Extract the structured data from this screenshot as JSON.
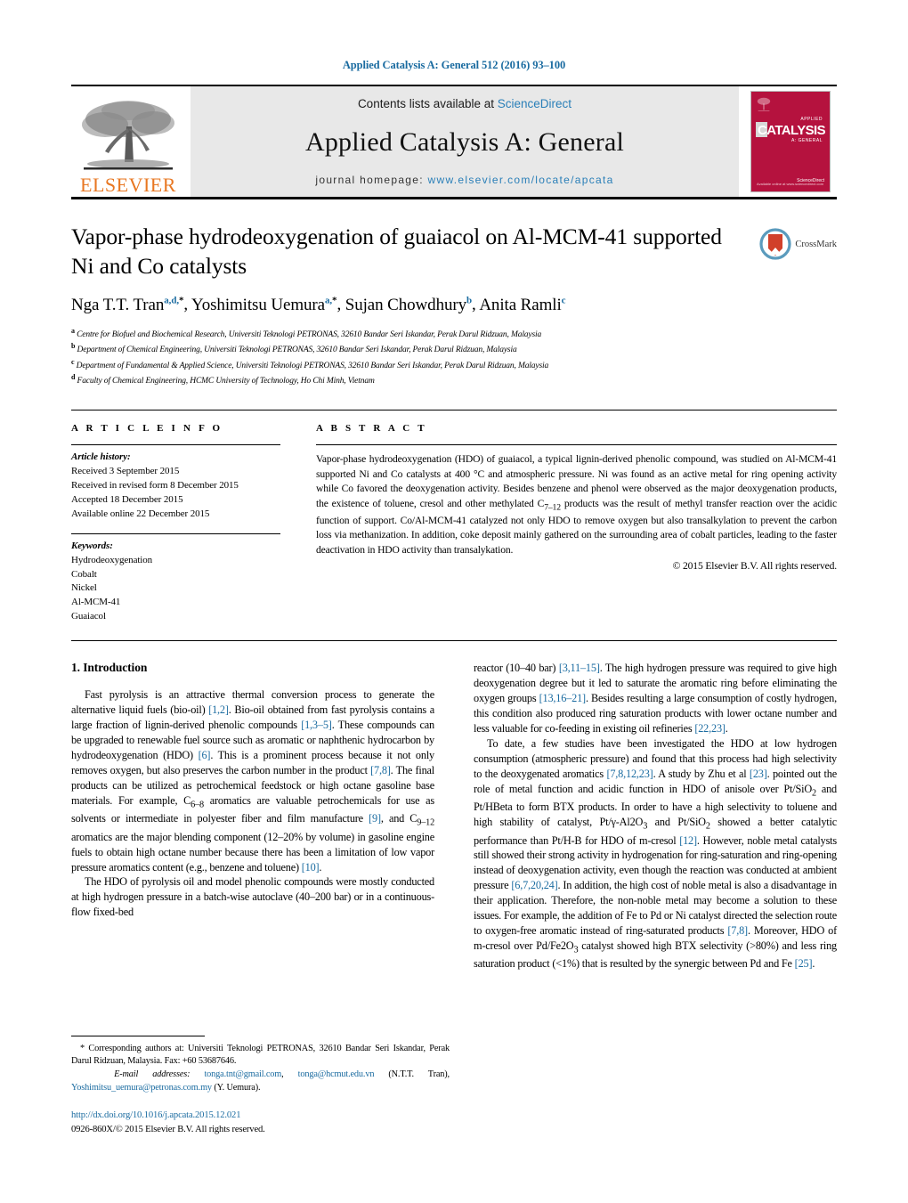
{
  "running_head": "Applied Catalysis A: General 512 (2016) 93–100",
  "masthead": {
    "publisher_wordmark": "ELSEVIER",
    "contents_prefix": "Contents lists available at ",
    "contents_link": "ScienceDirect",
    "journal_name": "Applied Catalysis A: General",
    "homepage_prefix": "journal homepage: ",
    "homepage_url": "www.elsevier.com/locate/apcata",
    "cover": {
      "title": "CATALYSIS",
      "sub_top": "APPLIED",
      "sub_bottom": "A: GENERAL",
      "footer_left": "Available online at www.sciencedirect.com",
      "footer_right": "ScienceDirect"
    }
  },
  "crossmark": {
    "label": "CrossMark"
  },
  "article": {
    "title": "Vapor-phase hydrodeoxygenation of guaiacol on Al-MCM-41 supported Ni and Co catalysts",
    "authors": [
      {
        "name": "Nga T.T. Tran",
        "marks": "a,d,",
        "star": true,
        "sep": ", "
      },
      {
        "name": "Yoshimitsu Uemura",
        "marks": "a,",
        "star": true,
        "sep": ", "
      },
      {
        "name": "Sujan Chowdhury",
        "marks": "b",
        "star": false,
        "sep": ", "
      },
      {
        "name": "Anita Ramli",
        "marks": "c",
        "star": false,
        "sep": ""
      }
    ],
    "affiliations": [
      {
        "mark": "a",
        "text": "Centre for Biofuel and Biochemical Research, Universiti Teknologi PETRONAS, 32610 Bandar Seri Iskandar, Perak Darul Ridzuan, Malaysia"
      },
      {
        "mark": "b",
        "text": "Department of Chemical Engineering, Universiti Teknologi PETRONAS, 32610 Bandar Seri Iskandar, Perak Darul Ridzuan, Malaysia"
      },
      {
        "mark": "c",
        "text": "Department of Fundamental & Applied Science, Universiti Teknologi PETRONAS, 32610 Bandar Seri Iskandar, Perak Darul Ridzuan, Malaysia"
      },
      {
        "mark": "d",
        "text": "Faculty of Chemical Engineering, HCMC University of Technology, Ho Chi Minh, Vietnam"
      }
    ]
  },
  "article_info": {
    "heading": "A R T I C L E  I N F O",
    "history_label": "Article history:",
    "history": [
      "Received 3 September 2015",
      "Received in revised form 8 December 2015",
      "Accepted 18 December 2015",
      "Available online 22 December 2015"
    ],
    "keywords_label": "Keywords:",
    "keywords": [
      "Hydrodeoxygenation",
      "Cobalt",
      "Nickel",
      "Al-MCM-41",
      "Guaiacol"
    ]
  },
  "abstract": {
    "heading": "A B S T R A C T",
    "text": "Vapor-phase hydrodeoxygenation (HDO) of guaiacol, a typical lignin-derived phenolic compound, was studied on Al-MCM-41 supported Ni and Co catalysts at 400 °C and atmospheric pressure. Ni was found as an active metal for ring opening activity while Co favored the deoxygenation activity. Besides benzene and phenol were observed as the major deoxygenation products, the existence of toluene, cresol and other methylated C7–12 products was the result of methyl transfer reaction over the acidic function of support. Co/Al-MCM-41 catalyzed not only HDO to remove oxygen but also transalkylation to prevent the carbon loss via methanization. In addition, coke deposit mainly gathered on the surrounding area of cobalt particles, leading to the faster deactivation in HDO activity than transalykation.",
    "copyright": "© 2015 Elsevier B.V. All rights reserved."
  },
  "body": {
    "section_number_title": "1.  Introduction",
    "left_paragraphs": [
      "Fast pyrolysis is an attractive thermal conversion process to generate the alternative liquid fuels (bio-oil) [1,2]. Bio-oil obtained from fast pyrolysis contains a large fraction of lignin-derived phenolic compounds [1,3–5]. These compounds can be upgraded to renewable fuel source such as aromatic or naphthenic hydrocarbon by hydrodeoxygenation (HDO) [6]. This is a prominent process because it not only removes oxygen, but also preserves the carbon number in the product [7,8]. The final products can be utilized as petrochemical feedstock or high octane gasoline base materials. For example, C6–8 aromatics are valuable petrochemicals for use as solvents or intermediate in polyester fiber and film manufacture [9], and C9–12 aromatics are the major blending component (12–20% by volume) in gasoline engine fuels to obtain high octane number because there has been a limitation of low vapor pressure aromatics content (e.g., benzene and toluene) [10].",
      "The HDO of pyrolysis oil and model phenolic compounds were mostly conducted at high hydrogen pressure in a batch-wise autoclave (40–200 bar) or in a continuous-flow fixed-bed"
    ],
    "right_paragraphs": [
      "reactor (10–40 bar) [3,11–15]. The high hydrogen pressure was required to give high deoxygenation degree but it led to saturate the aromatic ring before eliminating the oxygen groups [13,16–21]. Besides resulting a large consumption of costly hydrogen, this condition also produced ring saturation products with lower octane number and less valuable for co-feeding in existing oil refineries [22,23].",
      "To date, a few studies have been investigated the HDO at low hydrogen consumption (atmospheric pressure) and found that this process had high selectivity to the deoxygenated aromatics [7,8,12,23]. A study by Zhu et al [23]. pointed out the role of metal function and acidic function in HDO of anisole over Pt/SiO2 and Pt/HBeta to form BTX products. In order to have a high selectivity to toluene and high stability of catalyst, Pt/γ-Al2O3 and Pt/SiO2 showed a better catalytic performance than Pt/H-B for HDO of m-cresol [12]. However, noble metal catalysts still showed their strong activity in hydrogenation for ring-saturation and ring-opening instead of deoxygenation activity, even though the reaction was conducted at ambient pressure [6,7,20,24]. In addition, the high cost of noble metal is also a disadvantage in their application. Therefore, the non-noble metal may become a solution to these issues. For example, the addition of Fe to Pd or Ni catalyst directed the selection route to oxygen-free aromatic instead of ring-saturated products [7,8]. Moreover, HDO of m-cresol over Pd/Fe2O3 catalyst showed high BTX selectivity (>80%) and less ring saturation product (<1%) that is resulted by the synergic between Pd and Fe [25]."
    ]
  },
  "footnotes": {
    "corresponding": "* Corresponding authors at: Universiti Teknologi PETRONAS, 32610 Bandar Seri Iskandar, Perak Darul Ridzuan, Malaysia. Fax: +60 53687646.",
    "email_label": "E-mail addresses:",
    "emails": [
      {
        "address": "tonga.tnt@gmail.com",
        "trailing": ", "
      },
      {
        "address": "tonga@hcmut.edu.vn",
        "trailing": " (N.T.T. Tran), "
      },
      {
        "address": "Yoshimitsu_uemura@petronas.com.my",
        "trailing": " (Y. Uemura)."
      }
    ],
    "doi": "http://dx.doi.org/10.1016/j.apcata.2015.12.021",
    "issn_line": "0926-860X/© 2015 Elsevier B.V. All rights reserved."
  },
  "colors": {
    "link_blue": "#1a6ba0",
    "elsevier_orange": "#E87722",
    "cover_red": "#b5123e",
    "band_gray": "#e8e8e8"
  }
}
